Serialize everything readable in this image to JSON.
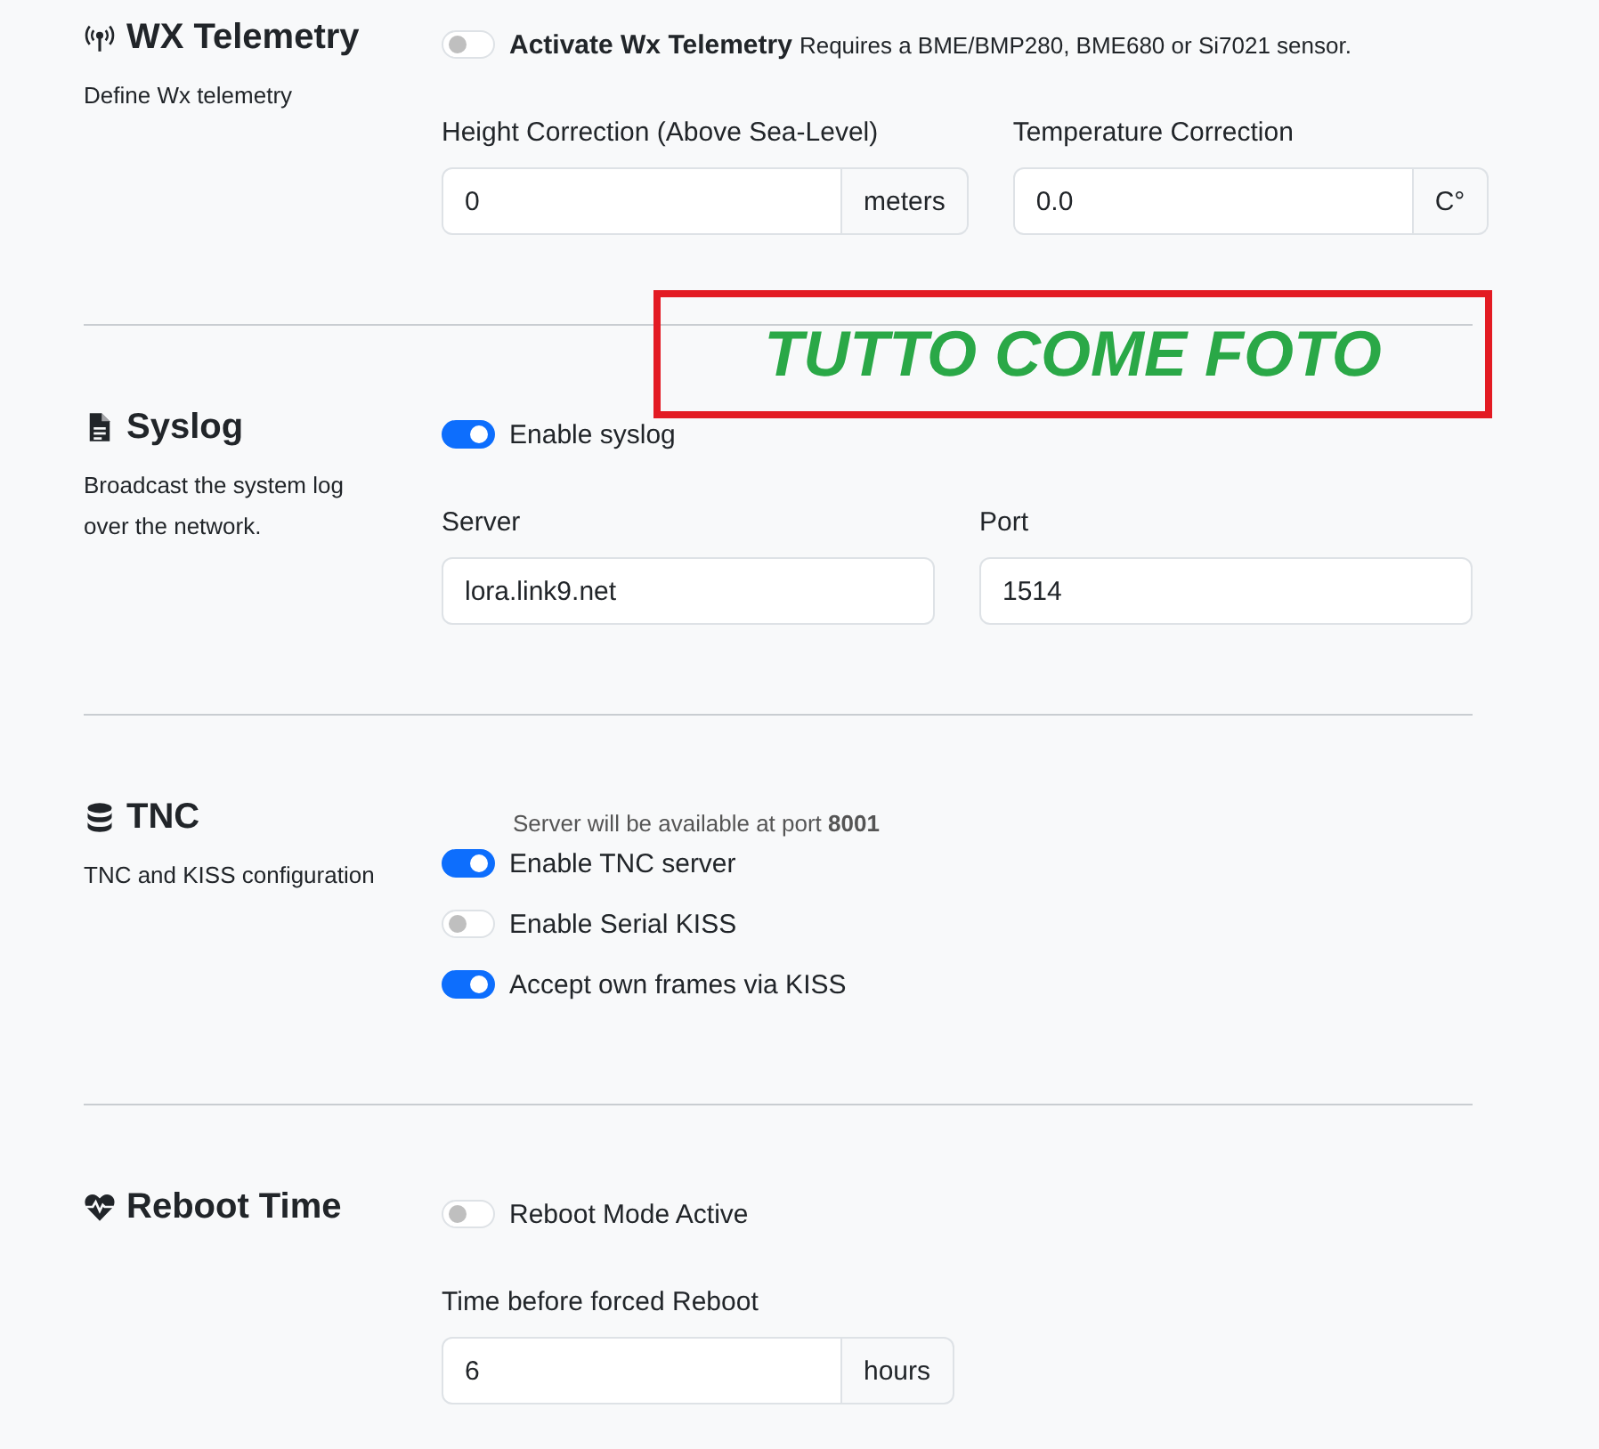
{
  "sections": [
    {
      "title": "WX Telemetry",
      "description": "Define Wx telemetry",
      "controls": [
        {
          "kind": "switch",
          "label": "Activate Wx Telemetry",
          "strong": true,
          "hint": "Requires a BME/BMP280, BME680 or Si7021 sensor.",
          "on": false
        },
        {
          "kind": "fields",
          "fields": [
            {
              "label": "Height Correction (Above Sea-Level)",
              "value": "0",
              "unit": "meters"
            },
            {
              "label": "Temperature Correction",
              "value": "0.0",
              "unit": "C°"
            }
          ]
        }
      ]
    },
    {
      "title": "Syslog",
      "description": "Broadcast the system log over the network.",
      "controls": [
        {
          "kind": "switch",
          "label": "Enable syslog",
          "on": true
        },
        {
          "kind": "fields",
          "fields": [
            {
              "label": "Server",
              "value": "lora.link9.net"
            },
            {
              "label": "Port",
              "value": "1514"
            }
          ]
        }
      ]
    },
    {
      "title": "TNC",
      "description": "TNC and KISS configuration",
      "controls": [
        {
          "kind": "note",
          "text": "Server will be available at port **8001**"
        },
        {
          "kind": "switch",
          "label": "Enable TNC server",
          "on": true
        },
        {
          "kind": "switch",
          "label": "Enable Serial KISS",
          "on": false
        },
        {
          "kind": "switch",
          "label": "Accept own frames via KISS",
          "on": true
        }
      ]
    },
    {
      "title": "Reboot Time",
      "controls": [
        {
          "kind": "switch",
          "label": "Reboot Mode Active",
          "on": false
        },
        {
          "kind": "fields",
          "fields": [
            {
              "label": "Time before forced Reboot",
              "value": "6",
              "unit": "hours"
            }
          ]
        }
      ]
    }
  ],
  "annotation": {
    "text": "TUTTO COME FOTO"
  }
}
